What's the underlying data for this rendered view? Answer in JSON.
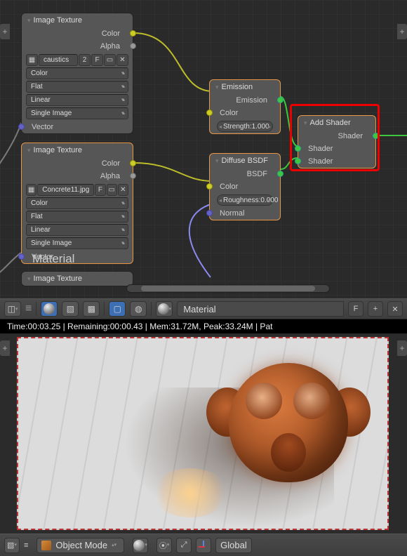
{
  "node_editor": {
    "material_label": "Material",
    "tex1": {
      "title": "Image Texture",
      "out_color": "Color",
      "out_alpha": "Alpha",
      "file": "caustics",
      "users": "2",
      "fake": "F",
      "color_space": "Color",
      "projection": "Flat",
      "interpolation": "Linear",
      "source": "Single Image",
      "in_vector": "Vector"
    },
    "tex2": {
      "title": "Image Texture",
      "out_color": "Color",
      "out_alpha": "Alpha",
      "file": "Concrete11.jpg",
      "fake": "F",
      "color_space": "Color",
      "projection": "Flat",
      "interpolation": "Linear",
      "source": "Single Image",
      "in_vector": "Vector"
    },
    "tex3_title": "Image Texture",
    "emission": {
      "title": "Emission",
      "out": "Emission",
      "in_color": "Color",
      "strength_label": "Strength:",
      "strength_val": "1.000"
    },
    "diffuse": {
      "title": "Diffuse BSDF",
      "out": "BSDF",
      "in_color": "Color",
      "rough_label": "Roughness:",
      "rough_val": "0.000",
      "in_normal": "Normal"
    },
    "add": {
      "title": "Add Shader",
      "out": "Shader",
      "in1": "Shader",
      "in2": "Shader"
    }
  },
  "toolbar": {
    "material_name": "Material",
    "fake_user": "F",
    "plus": "+"
  },
  "render_status": "Time:00:03.25 | Remaining:00:00.43 | Mem:31.72M, Peak:33.24M | Pat",
  "bottom": {
    "mode": "Object Mode",
    "orientation": "Global"
  }
}
